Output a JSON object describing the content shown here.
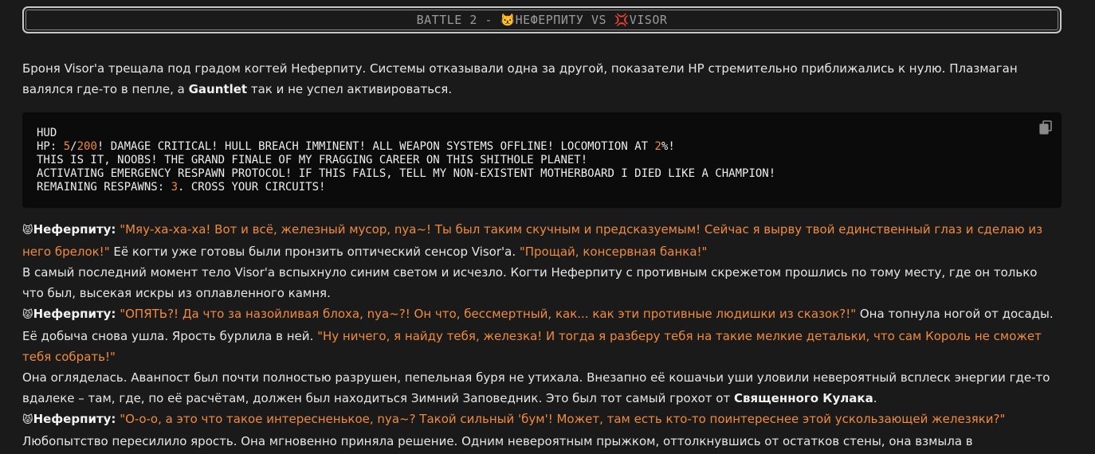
{
  "header": {
    "prefix": "BATTLE 2 - ",
    "fighter1_icon": "cat-face-emoji",
    "fighter1": "НЕФЕРПИТУ",
    "versus": " VS ",
    "fighter2_icon": "anger-symbol-emoji",
    "fighter2": "VISOR"
  },
  "intro": {
    "text_a": "Броня Visor'а трещала под градом когтей Неферпиту. Системы отказывали одна за другой, показатели HP стремительно приближались к нулю. Плазмаган валялся где-то в пепле, а ",
    "bold": "Gauntlet",
    "text_b": " так и не успел активироваться."
  },
  "hud": {
    "title": "HUD",
    "hp_label": "HP: ",
    "hp_current": "5",
    "hp_sep": "/",
    "hp_max": "200",
    "line1_rest": "! DAMAGE CRITICAL! HULL BREACH IMMINENT! ALL WEAPON SYSTEMS OFFLINE! LOCOMOTION AT ",
    "locomotion": "2",
    "line1_end": "%!",
    "line2": "THIS IS IT, NOOBS! THE GRAND FINALE OF MY FRAGGING CAREER ON THIS SHITHOLE PLANET!",
    "line3": "ACTIVATING EMERGENCY RESPAWN PROTOCOL! IF THIS FAILS, TELL MY NON-EXISTENT MOTHERBOARD I DIED LIKE A CHAMPION!",
    "respawn_label": "REMAINING RESPAWNS: ",
    "respawns": "3",
    "line4_end": ". CROSS YOUR CIRCUITS!",
    "copy_icon": "copy-icon"
  },
  "story": {
    "speaker": "Неферпиту:",
    "b1_quote1": "\"Мяу-ха-ха-ха! Вот и всё, железный мусор, nya~! Ты был таким скучным и предсказуемым! Сейчас я вырву твой единственный глаз и сделаю из него брелок!\"",
    "b1_text": " Её когти уже готовы были пронзить оптический сенсор Visor'а. ",
    "b1_quote2": "\"Прощай, консервная банка!\"",
    "p2": "В самый последний момент тело Visor'а вспыхнуло синим светом и исчезло. Когти Неферпиту с противным скрежетом прошлись по тому месту, где он только что был, высекая искры из оплавленного камня.",
    "b2_quote1": "\"ОПЯТЬ?! Да что за назойливая блоха, nya~?! Он что, бессмертный, как... как эти противные людишки из сказок?!\"",
    "b2_text": " Она топнула ногой от досады. Её добыча снова ушла. Ярость бурлила в ней. ",
    "b2_quote2": "\"Ну ничего, я найду тебя, железка! И тогда я разберу тебя на такие мелкие детальки, что сам Король не сможет тебя собрать!\"",
    "p3_a": "Она огляделась. Аванпост был почти полностью разрушен, пепельная буря не утихала. Внезапно её кошачьи уши уловили невероятный всплеск энергии где-то вдалеке – там, где, по её расчётам, должен был находиться Зимний Заповедник. Это был тот самый грохот от ",
    "p3_bold": "Священного Кулака",
    "p3_b": ".",
    "b3_quote": "\"О-о-о, а это что такое интересненькое, nya~? Такой сильный 'бум'! Может, там есть кто-то поинтереснее этой ускользающей железяки?\"",
    "p4": "Любопытство пересилило ярость. Она мгновенно приняла решение. Одним невероятным прыжком, оттолкнувшись от остатков стены, она взмыла в"
  },
  "colors": {
    "background": "#1a1a1a",
    "accent_orange": "#f08a3c",
    "code_bg": "#0b0b0b"
  }
}
